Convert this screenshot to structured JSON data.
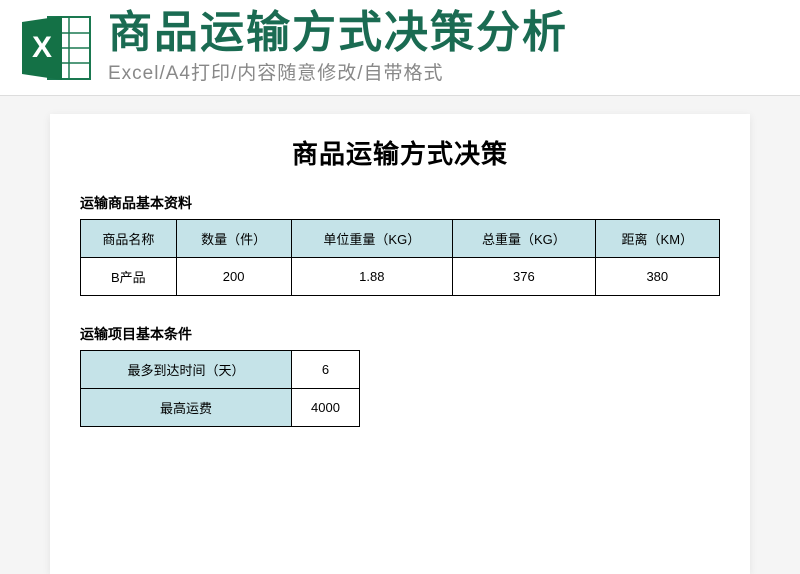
{
  "header": {
    "icon_letter": "X",
    "main_title": "商品运输方式决策分析",
    "sub_title": "Excel/A4打印/内容随意修改/自带格式"
  },
  "doc": {
    "title": "商品运输方式决策",
    "section1_label": "运输商品基本资料",
    "table1": {
      "headers": [
        "商品名称",
        "数量（件）",
        "单位重量（KG）",
        "总重量（KG）",
        "距离（KM）"
      ],
      "row": [
        "B产品",
        "200",
        "1.88",
        "376",
        "380"
      ]
    },
    "section2_label": "运输项目基本条件",
    "table2": {
      "rows": [
        {
          "label": "最多到达时间（天）",
          "value": "6"
        },
        {
          "label": "最高运费",
          "value": "4000"
        }
      ]
    }
  }
}
